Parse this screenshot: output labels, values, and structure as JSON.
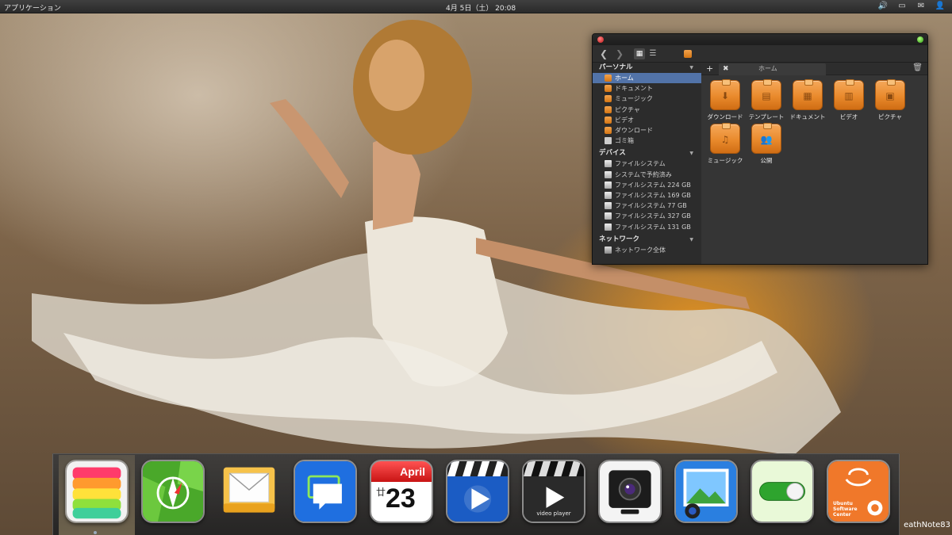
{
  "top_panel": {
    "apps_menu": "アプリケーション",
    "clock": "4月 5日（土） 20:08",
    "tray_icons": [
      "volume-icon",
      "display-icon",
      "mail-icon",
      "user-icon"
    ]
  },
  "file_manager": {
    "tabs": {
      "home_label": "ホーム"
    },
    "sidebar": {
      "personal_heading": "パーソナル",
      "personal": [
        {
          "label": "ホーム",
          "icon": "folder",
          "selected": true
        },
        {
          "label": "ドキュメント",
          "icon": "folder"
        },
        {
          "label": "ミュージック",
          "icon": "folder"
        },
        {
          "label": "ピクチャ",
          "icon": "folder"
        },
        {
          "label": "ビデオ",
          "icon": "folder"
        },
        {
          "label": "ダウンロード",
          "icon": "folder"
        },
        {
          "label": "ゴミ箱",
          "icon": "trash"
        }
      ],
      "devices_heading": "デバイス",
      "devices": [
        {
          "label": "ファイルシステム"
        },
        {
          "label": "システムで予約済み"
        },
        {
          "label": "ファイルシステム 224 GB"
        },
        {
          "label": "ファイルシステム 169 GB"
        },
        {
          "label": "ファイルシステム 77 GB"
        },
        {
          "label": "ファイルシステム 327 GB"
        },
        {
          "label": "ファイルシステム 131 GB"
        }
      ],
      "network_heading": "ネットワーク",
      "network": [
        {
          "label": "ネットワーク全体"
        }
      ]
    },
    "folders": [
      {
        "label": "ダウンロード",
        "glyph": "⬇"
      },
      {
        "label": "テンプレート",
        "glyph": "▤"
      },
      {
        "label": "ドキュメント",
        "glyph": "▦"
      },
      {
        "label": "ビデオ",
        "glyph": "▥"
      },
      {
        "label": "ピクチャ",
        "glyph": "▣"
      },
      {
        "label": "ミュージック",
        "glyph": "♫"
      },
      {
        "label": "公開",
        "glyph": "👥"
      }
    ]
  },
  "dock": {
    "calendar_month": "April",
    "calendar_day": "23",
    "calendar_lunar": "廿",
    "video_label": "video player",
    "software_center_label": "Ubuntu Software Center"
  },
  "watermark": "eathNote83",
  "colors": {
    "selection": "#5273a8",
    "folder_orange": "#e98a2c"
  }
}
